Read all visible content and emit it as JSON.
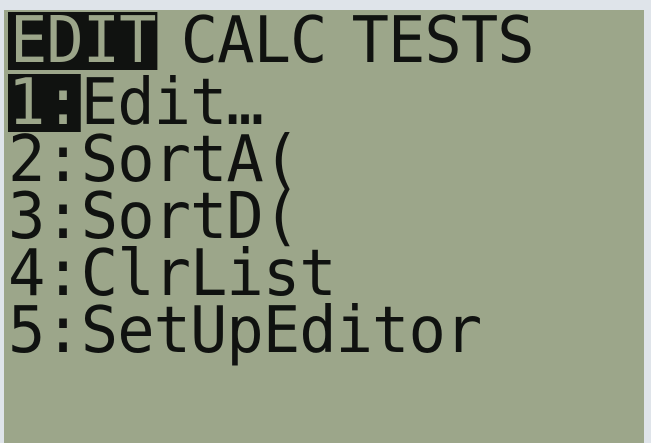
{
  "tabs": [
    {
      "label": "EDIT",
      "active": true
    },
    {
      "label": "CALC",
      "active": false
    },
    {
      "label": "TESTS",
      "active": false
    }
  ],
  "menu": {
    "selected_index": 0,
    "items": [
      {
        "number": "1:",
        "label": "Edit…"
      },
      {
        "number": "2:",
        "label": "SortA("
      },
      {
        "number": "3:",
        "label": "SortD("
      },
      {
        "number": "4:",
        "label": "ClrList"
      },
      {
        "number": "5:",
        "label": "SetUpEditor"
      }
    ]
  },
  "colors": {
    "lcd_background": "#9ca68a",
    "pixel_dark": "#101210"
  }
}
